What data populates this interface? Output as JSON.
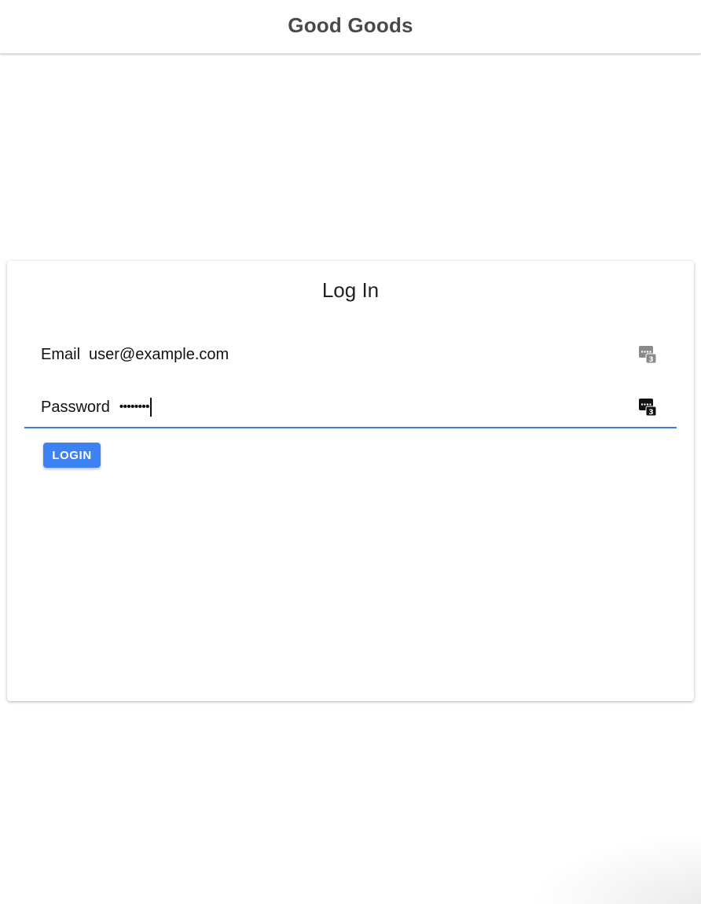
{
  "header": {
    "title": "Good Goods"
  },
  "login_form": {
    "title": "Log In",
    "email": {
      "label": "Email",
      "value": "user@example.com",
      "icon": "password-manager-key-icon"
    },
    "password": {
      "label": "Password",
      "value": "••••••••",
      "icon": "password-manager-key-icon"
    },
    "submit_label": "LOGIN"
  },
  "colors": {
    "accent": "#3d82f2",
    "focus_underline": "#3f7fde"
  }
}
